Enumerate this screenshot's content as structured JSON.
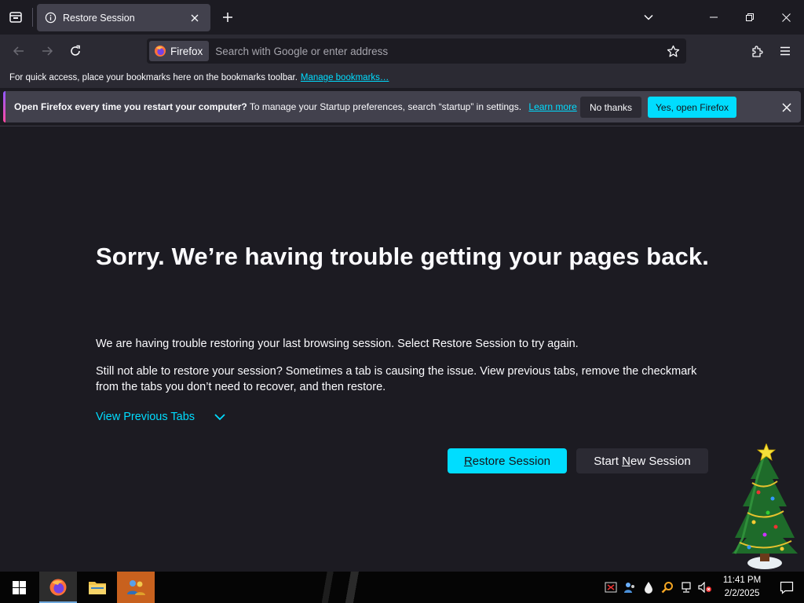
{
  "tab": {
    "title": "Restore Session"
  },
  "navbar": {
    "identity_label": "Firefox",
    "url_placeholder": "Search with Google or enter address"
  },
  "bookmarks_bar": {
    "text": "For quick access, place your bookmarks here on the bookmarks toolbar.",
    "link": "Manage bookmarks…"
  },
  "notification": {
    "bold": "Open Firefox every time you restart your computer?",
    "text": "To manage your Startup preferences, search “startup” in settings.",
    "learn_more": "Learn more",
    "no_thanks": "No thanks",
    "yes": "Yes, open Firefox"
  },
  "main": {
    "heading": "Sorry. We’re having trouble getting your pages back.",
    "para1": "We are having trouble restoring your last browsing session. Select Restore Session to try again.",
    "para2": "Still not able to restore your session? Sometimes a tab is causing the issue. View previous tabs, remove the checkmark from the tabs you don’t need to recover, and then restore.",
    "view_previous": "View Previous Tabs",
    "restore_button": {
      "accel": "R",
      "rest": "estore Session"
    },
    "new_session_button": {
      "pre": "Start ",
      "accel": "N",
      "rest": "ew Session"
    }
  },
  "taskbar": {
    "time": "11:41 PM",
    "date": "2/2/2025"
  },
  "colors": {
    "accent": "#00ddff",
    "background": "#1c1b22",
    "toolbar": "#2b2a33"
  }
}
